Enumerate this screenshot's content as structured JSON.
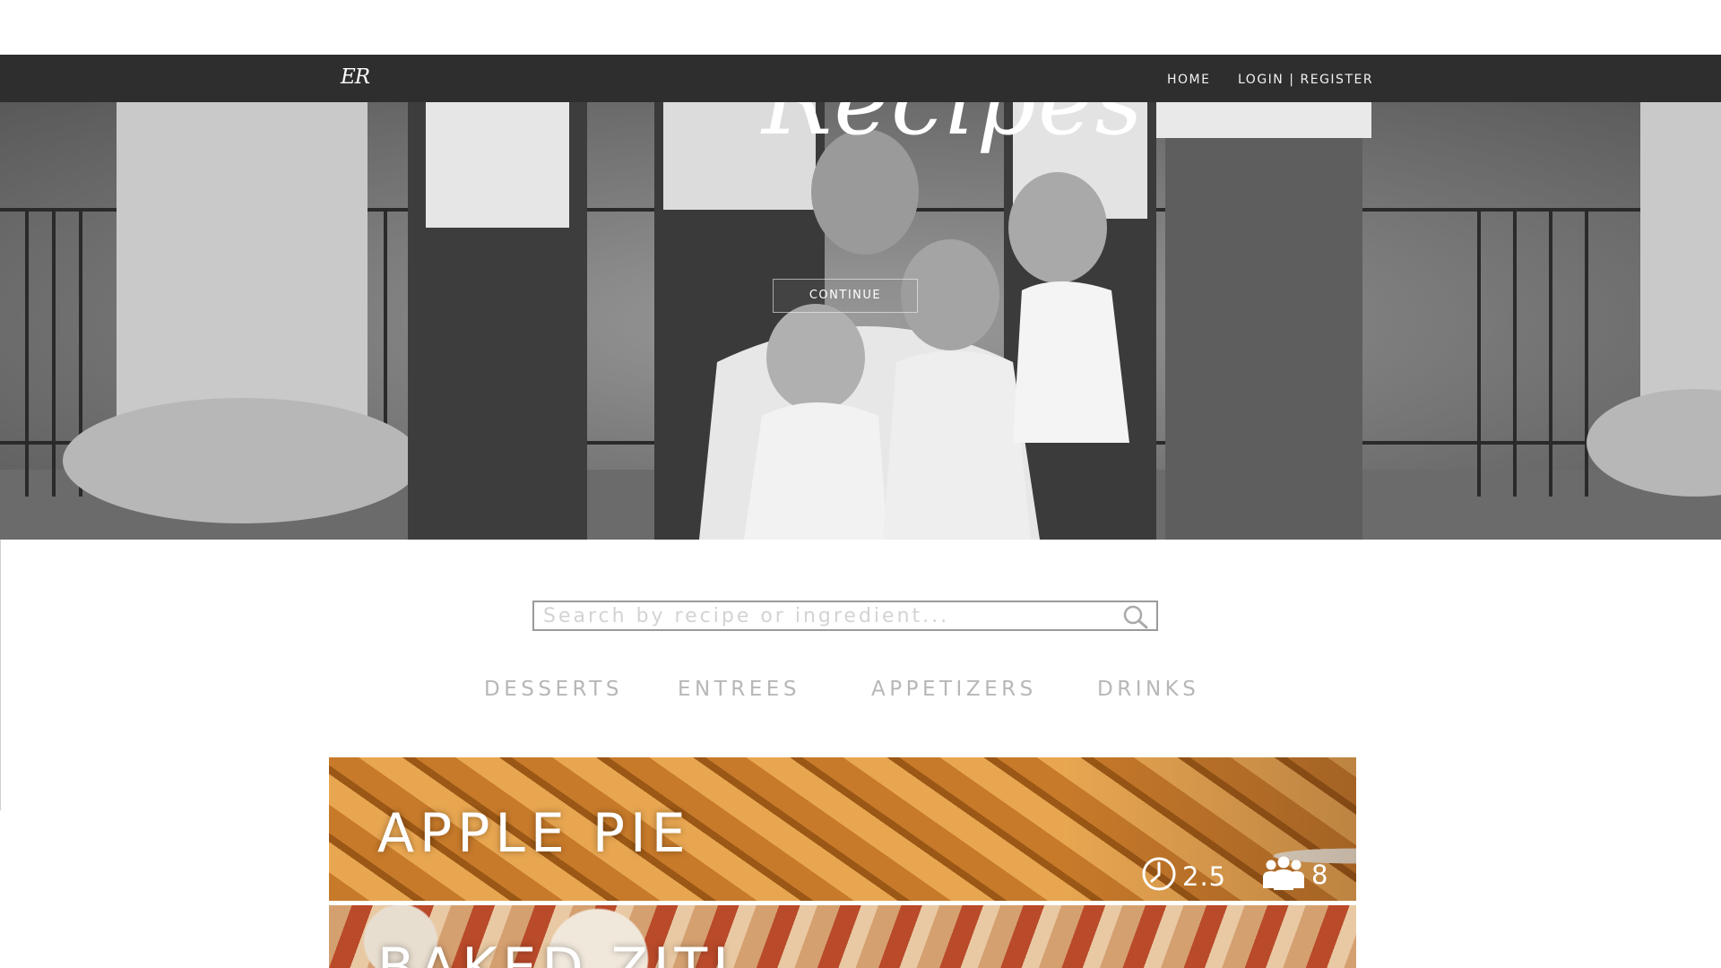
{
  "nav": {
    "logo": "ER",
    "home": "HOME",
    "login": "LOGIN",
    "separator": "|",
    "register": "REGISTER"
  },
  "hero": {
    "title": "Recipes",
    "continue_label": "CONTINUE"
  },
  "search": {
    "placeholder": "Search by recipe or ingredient...",
    "value": ""
  },
  "categories": [
    "DESSERTS",
    "ENTREES",
    "APPETIZERS",
    "DRINKS"
  ],
  "recipes": [
    {
      "title": "APPLE PIE",
      "time": "2.5",
      "serves": "8",
      "time_icon": "clock-icon",
      "serves_icon": "people-icon"
    },
    {
      "title": "BAKED ZITI"
    }
  ]
}
